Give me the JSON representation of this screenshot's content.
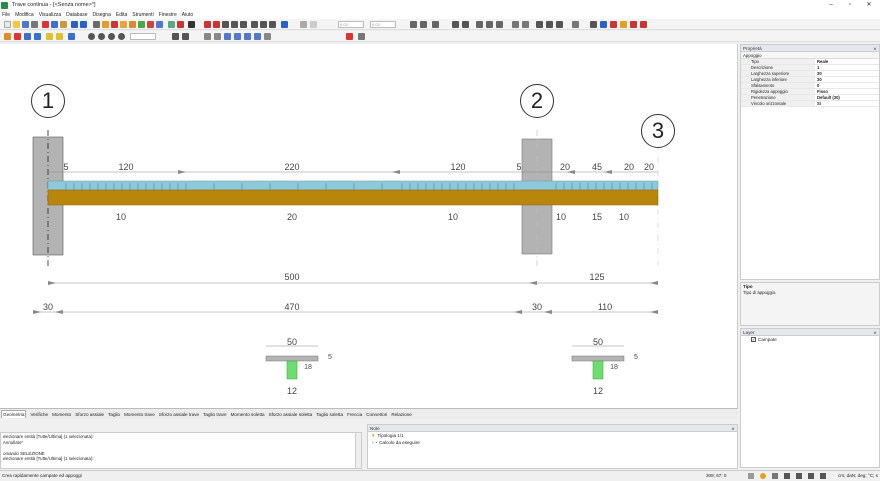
{
  "window": {
    "title": "Trave continua - [<Senza nome>*]",
    "minimize": "–",
    "maximize": "▫",
    "close": "✕"
  },
  "menu": [
    "File",
    "Modifica",
    "Visualizza",
    "Database",
    "Disegna",
    "Edita",
    "Strumenti",
    "Finestre",
    "Aiuto"
  ],
  "toolbar": {
    "field1": "0.02",
    "field2": "0.02"
  },
  "drawing": {
    "supports": [
      "1",
      "2",
      "3"
    ],
    "top_dims": [
      "5",
      "120",
      "220",
      "120",
      "5",
      "20",
      "45",
      "20",
      "20"
    ],
    "bottom_dims": [
      "10",
      "20",
      "10",
      "10",
      "15",
      "10"
    ],
    "total_dims": [
      "500",
      "125"
    ],
    "lower_dims": [
      "30",
      "470",
      "30",
      "110"
    ],
    "section_left": {
      "width": "50",
      "flange": "5",
      "web_h": "18",
      "web_w": "12"
    },
    "section_right": {
      "width": "50",
      "flange": "5",
      "web_h": "18",
      "web_w": "12"
    }
  },
  "properties": {
    "panel_title": "Proprietà",
    "group": "Appoggio",
    "rows": [
      {
        "k": "Tipo",
        "v": "Reale"
      },
      {
        "k": "Descrizione",
        "v": "1"
      },
      {
        "k": "Larghezza superiore",
        "v": "30"
      },
      {
        "k": "Larghezza inferiore",
        "v": "30"
      },
      {
        "k": "Sfalsamento",
        "v": "0"
      },
      {
        "k": "Rigidezza appoggio",
        "v": "Fisso"
      },
      {
        "k": "Penetrazione",
        "v": "Default (30)"
      },
      {
        "k": "Vincolo orizzontale",
        "v": "Sì"
      }
    ],
    "help_title": "Tipo",
    "help_text": "Tipo di appoggio."
  },
  "layer": {
    "panel_title": "Layer",
    "item": "Campate"
  },
  "tabs": [
    "Geometria",
    "Verifiche",
    "Momento",
    "Sforzo assiale",
    "Taglio",
    "Momento trave",
    "Sforzo assiale trave",
    "Taglio trave",
    "Momento soletta",
    "Sforzo assiale soletta",
    "Taglio soletta",
    "Freccia",
    "Connettori",
    "Relazione"
  ],
  "command_lines": [
    "elezionare entità [Tutte/Ultima] (1 selezionata):",
    "Annullato*",
    "",
    "omando SELEZIONE",
    "elezionare entità [Tutte/Ultima] (1 selezionata):"
  ],
  "notes": {
    "panel_title": "Note",
    "filter": "Tipologia 1/1",
    "item": "Calcolo da eseguire"
  },
  "status": {
    "message": "Crea rapidamente campate ed appoggi",
    "coords": "308; 67; 0",
    "units": "cm; daN; deg; °C; s"
  },
  "colors": {
    "beam": "#b8860b",
    "slab_top": "#8fc8d8",
    "column": "#b3b3b3",
    "web": "#6fdc6f"
  }
}
